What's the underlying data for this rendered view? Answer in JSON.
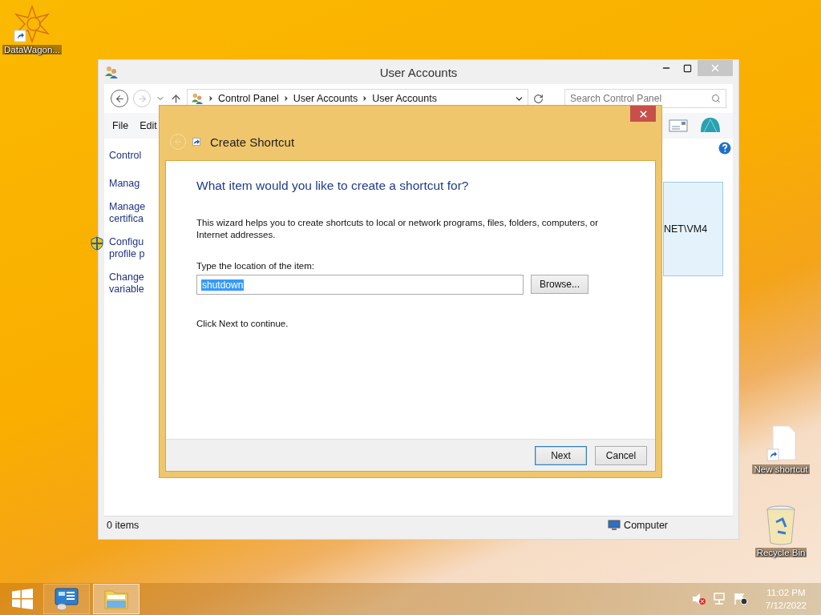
{
  "desktop_icons": [
    {
      "label": "DataWagon...",
      "kind": "app"
    },
    {
      "label": "New shortcut",
      "kind": "file"
    },
    {
      "label": "Recycle Bin",
      "kind": "bin"
    }
  ],
  "window": {
    "title": "User Accounts",
    "nav": {
      "back_disabled": false,
      "forward_disabled": true
    },
    "breadcrumbs": [
      "Control Panel",
      "User Accounts",
      "User Accounts"
    ],
    "search": {
      "placeholder": "Search Control Panel"
    },
    "menu": [
      "File",
      "Edit"
    ],
    "sidebar": {
      "items": [
        {
          "lines": [
            "Control"
          ],
          "shield": false
        },
        {
          "lines": [
            "Manag"
          ],
          "shield": false
        },
        {
          "lines": [
            "Manage",
            "certifica"
          ],
          "shield": false
        },
        {
          "lines": [
            "Configu",
            "profile p"
          ],
          "shield": true
        },
        {
          "lines": [
            "Change",
            "variable"
          ],
          "shield": false
        }
      ]
    },
    "account_box": {
      "text": "NET\\VM4"
    },
    "status_bar": {
      "count": "0 items",
      "location": "Computer"
    }
  },
  "dialog": {
    "title": "Create Shortcut",
    "heading": "What item would you like to create a shortcut for?",
    "description": "This wizard helps you to create shortcuts to local or network programs, files, folders, computers, or Internet addresses.",
    "field_label": "Type the location of the item:",
    "location": {
      "value": "shutdown",
      "selected": true
    },
    "browse": "Browse...",
    "hint": "Click Next to continue.",
    "buttons": [
      {
        "label": "Next",
        "default": true
      },
      {
        "label": "Cancel",
        "default": false
      }
    ]
  },
  "taskbar": {
    "items": [
      {
        "kind": "control-panel",
        "selected": false
      },
      {
        "kind": "explorer",
        "selected": true
      }
    ],
    "clock": {
      "time": "11:02 PM",
      "date": "7/12/2022"
    }
  }
}
